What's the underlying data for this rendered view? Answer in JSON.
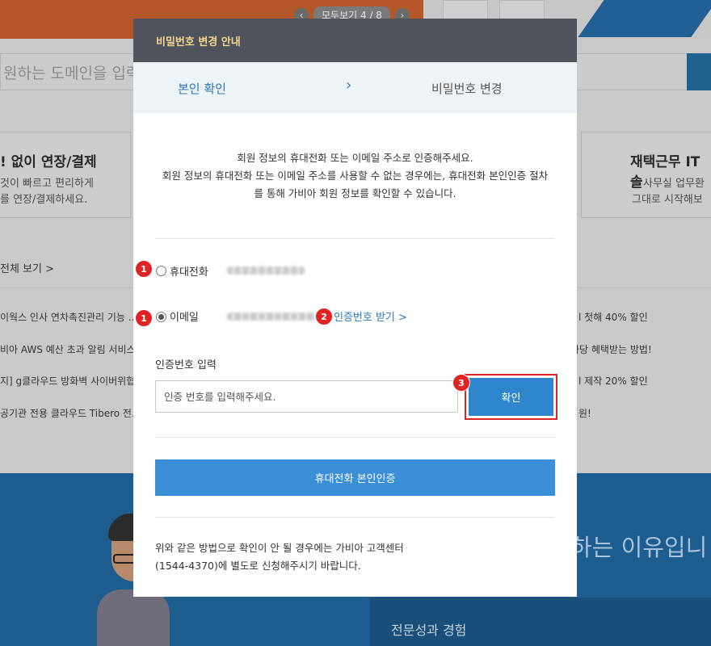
{
  "background": {
    "carousel": {
      "prev_icon": "chevron-left-icon",
      "label": "모두보기",
      "counter": "4 / 8",
      "next_icon": "chevron-right-icon"
    },
    "search": {
      "placeholder": "원하는 도메인을 입력"
    },
    "cards": [
      {
        "title": "! 없이 연장/결제",
        "line1": "것이 빠르고 편리하게",
        "line2": "를 연장/결제하세요."
      },
      {
        "title": "재택근무 IT 솔",
        "line1": "사무실 업무환",
        "line2": "그대로 시작해보"
      }
    ],
    "view_all": "전체 보기 >",
    "news_left": [
      "이웍스 인사 연차촉진관리 기능 ...",
      "비아 AWS 예산 초과 알림 서비스...",
      "지] g클라우드 방화벽 사이버위협...",
      "공기관 전용 클라우드 Tibero 전..."
    ],
    "news_right": [
      "l 첫해 40% 할인",
      "하당 혜택받는 방법!",
      "l 제작 20% 할인",
      "원!"
    ],
    "band_text": "하는 이유입니",
    "panel_text": "전문성과 경험"
  },
  "modal": {
    "title": "비밀번호 변경 안내",
    "steps": {
      "active": "본인 확인",
      "separator": "›",
      "next": "비밀번호 변경"
    },
    "intro": [
      "회원 정보의 휴대전화 또는 이메일 주소로 인증해주세요.",
      "회원 정보의 휴대전화 또는 이메일 주소를 사용할 수 없는 경우에는, 휴대전화 본인인증 절차",
      "를 통해 가비아 회원 정보를 확인할 수 있습니다."
    ],
    "options": [
      {
        "label": "휴대전화",
        "checked": false,
        "badge": "1"
      },
      {
        "label": "이메일",
        "checked": true,
        "badge": "1"
      }
    ],
    "get_code": {
      "badge": "2",
      "label": "인증번호 받기 >"
    },
    "code_section": {
      "label": "인증번호 입력",
      "placeholder": "인증 번호를 입력해주세요.",
      "value": ""
    },
    "confirm": {
      "badge": "3",
      "label": "확인"
    },
    "phone_auth_label": "휴대전화 본인인증",
    "footer": [
      "위와 같은 방법으로 확인이 안 될 경우에는 가비아 고객센터",
      "(1544-4370)에 별도로 신청해주시기 바랍니다."
    ]
  },
  "colors": {
    "modal_header": "#4f545c",
    "modal_title": "#f3d58e",
    "accent_blue": "#2f86cc",
    "badge_red": "#e02424"
  }
}
